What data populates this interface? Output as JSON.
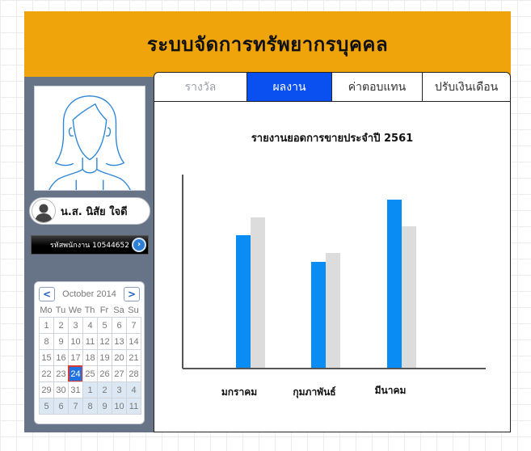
{
  "header": {
    "title": "ระบบจัดการทรัพยากรบุคคล"
  },
  "profile": {
    "name": "น.ส. นิสัย ใจดี",
    "employee_id_text": "รหัสพนักงาน 10544652"
  },
  "calendar": {
    "month_label": "October 2014",
    "prev_label": "<",
    "next_label": ">",
    "weekdays": [
      "Mo",
      "Tu",
      "We",
      "Th",
      "Fr",
      "Sa",
      "Su"
    ],
    "days": [
      "1",
      "2",
      "3",
      "4",
      "5",
      "6",
      "7",
      "8",
      "9",
      "10",
      "11",
      "12",
      "13",
      "14",
      "15",
      "16",
      "17",
      "18",
      "19",
      "20",
      "21",
      "22",
      "23",
      "24",
      "25",
      "26",
      "27",
      "28",
      "29",
      "30",
      "31",
      "1",
      "2",
      "3",
      "4",
      "5",
      "6",
      "7",
      "8",
      "9",
      "10",
      "11"
    ],
    "selected_day": "24"
  },
  "tabs": [
    {
      "label": "รางวัล",
      "state": "muted"
    },
    {
      "label": "ผลงาน",
      "state": "active"
    },
    {
      "label": "ค่าตอบแทน",
      "state": "normal"
    },
    {
      "label": "ปรับเงินเดือน",
      "state": "normal"
    }
  ],
  "colors": {
    "header": "#f0a40c",
    "sidebar": "#677488",
    "active_tab": "#0a50f0",
    "series_blue": "#0a8cf5",
    "series_gray": "#dcdcdc"
  },
  "chart_data": {
    "type": "bar",
    "title": "รายงานยอดการขายประจำปี 2561",
    "categories": [
      "มกราคม",
      "กุมภาพันธ์",
      "มีนาคม"
    ],
    "series": [
      {
        "values": [
          75,
          60,
          95
        ],
        "color": "#0a8cf5"
      },
      {
        "values": [
          85,
          65,
          80
        ],
        "color": "#dcdcdc"
      }
    ],
    "xlabel": "",
    "ylabel": "",
    "ylim": [
      0,
      100
    ],
    "grid": false,
    "legend": "none"
  }
}
